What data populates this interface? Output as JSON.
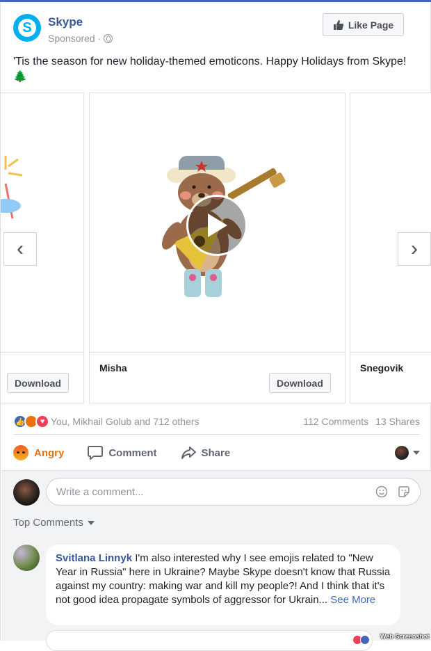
{
  "post": {
    "page_name": "Skype",
    "sponsored": "Sponsored",
    "sponsored_separator": "·",
    "like_page_label": "Like Page",
    "text": "'Tis the season for new holiday-themed emoticons. Happy Holidays from Skype!",
    "text_emoji": "🌲"
  },
  "carousel": {
    "slides": [
      {
        "title": "",
        "button": "Download"
      },
      {
        "title": "Misha",
        "button": "Download"
      },
      {
        "title": "Snegovik",
        "button": ""
      }
    ],
    "prev_arrow": "‹",
    "next_arrow": "›"
  },
  "engagement": {
    "reactors": "You, Mikhail Golub and 712 others",
    "comments_count": "112 Comments",
    "shares_count": "13 Shares",
    "reaction_types": [
      "like",
      "angry",
      "love"
    ]
  },
  "actions": {
    "reaction_label": "Angry",
    "comment_label": "Comment",
    "share_label": "Share"
  },
  "comments": {
    "input_placeholder": "Write a comment...",
    "sort_label": "Top Comments",
    "items": [
      {
        "author": "Svitlana Linnyk",
        "text": "I'm also interested why I see emojis related to \"New Year in Russia\" here in Ukraine? Maybe Skype doesn't know that Russia against my country: making war and kill my people?! And I think that it's not good idea propagate symbols of aggressor for Ukrain...",
        "see_more": "See More"
      }
    ]
  },
  "watermark": "Web Screenshot",
  "colors": {
    "facebook_blue": "#4267b2",
    "link_blue": "#365899",
    "skype_blue": "#00aff0",
    "angry_orange": "#e9710f",
    "love_red": "#f33e58"
  }
}
